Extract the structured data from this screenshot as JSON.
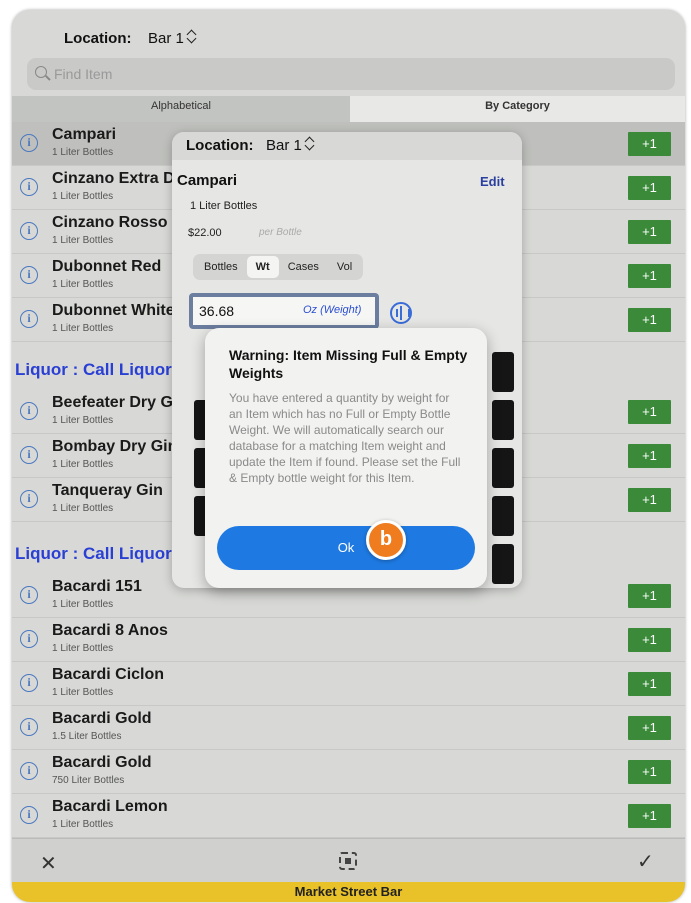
{
  "header": {
    "location_label": "Location:",
    "location_value": "Bar 1",
    "search_placeholder": "Find Item"
  },
  "segments": {
    "alphabetical": "Alphabetical",
    "by_category": "By Category"
  },
  "items": [
    {
      "name": "Campari",
      "size": "1 Liter Bottles",
      "action": "+1"
    },
    {
      "name": "Cinzano Extra Dry",
      "size": "1 Liter Bottles",
      "action": "+1"
    },
    {
      "name": "Cinzano Rosso",
      "size": "1 Liter Bottles",
      "action": "+1"
    },
    {
      "name": "Dubonnet Red",
      "size": "1 Liter Bottles",
      "action": "+1"
    },
    {
      "name": "Dubonnet White",
      "size": "1 Liter Bottles",
      "action": "+1"
    },
    {
      "name": "Beefeater Dry Gin",
      "size": "1 Liter Bottles",
      "action": "+1"
    },
    {
      "name": "Bombay Dry Gin",
      "size": "1 Liter Bottles",
      "action": "+1"
    },
    {
      "name": "Tanqueray Gin",
      "size": "1 Liter Bottles",
      "action": "+1"
    },
    {
      "name": "Bacardi 151",
      "size": "1 Liter Bottles",
      "action": "+1"
    },
    {
      "name": "Bacardi 8 Anos",
      "size": "1 Liter Bottles",
      "action": "+1"
    },
    {
      "name": "Bacardi Ciclon",
      "size": "1 Liter Bottles",
      "action": "+1"
    },
    {
      "name": "Bacardi Gold",
      "size": "1.5 Liter Bottles",
      "action": "+1"
    },
    {
      "name": "Bacardi Gold",
      "size": "750 Liter Bottles",
      "action": "+1"
    },
    {
      "name": "Bacardi Lemon",
      "size": "1 Liter Bottles",
      "action": "+1"
    }
  ],
  "sections": {
    "call_liquor_1": "Liquor : Call Liquor",
    "call_liquor_2": "Liquor : Call Liquor"
  },
  "popover": {
    "location_label": "Location:",
    "location_value": "Bar 1",
    "item_name": "Campari",
    "edit": "Edit",
    "size": "1 Liter Bottles",
    "price": "$22.00",
    "per": "per Bottle",
    "units": [
      "Bottles",
      "Wt",
      "Cases",
      "Vol"
    ],
    "active_unit": "Wt",
    "quantity": "36.68",
    "quantity_unit": "Oz (Weight)"
  },
  "alert": {
    "title": "Warning: Item Missing Full & Empty Weights",
    "body": "You have entered a quantity by weight for an Item which has no Full or Empty Bottle Weight. We will automatically search our database for a matching Item weight and update the Item if found. Please set the Full & Empty bottle weight for this Item.",
    "ok": "Ok",
    "badge": "b"
  },
  "footer": {
    "bar_name": "Market Street Bar"
  },
  "colors": {
    "accent_blue": "#1e7ae2",
    "plus_green": "#3a8a3a",
    "section_blue": "#2a3fd4",
    "footer_yellow": "#e9c22a",
    "badge_orange": "#ef7c1e"
  },
  "icons": [
    "search-icon",
    "info-icon",
    "close-icon",
    "scan-icon",
    "checkmark-icon",
    "waveform-icon",
    "up-down-chevron-icon"
  ]
}
